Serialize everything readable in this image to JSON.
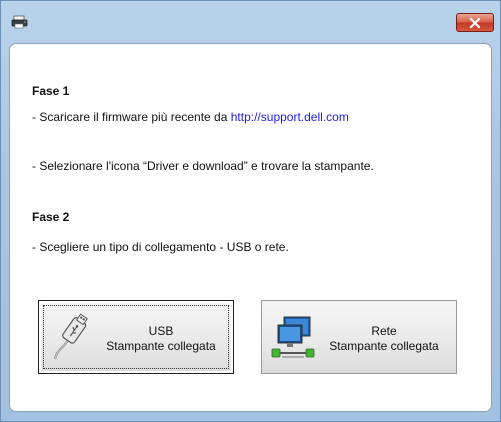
{
  "window": {
    "close_tooltip_icon": "close-icon",
    "app_icon": "printer-icon"
  },
  "step1": {
    "heading": "Fase 1",
    "line1_prefix": "- Scaricare il firmware più recente da ",
    "line1_link": "http://support.dell.com",
    "line2": "- Selezionare l'icona “Driver e download” e trovare la stampante."
  },
  "step2": {
    "heading": "Fase 2",
    "line1": "- Scegliere un tipo di collegamento - USB o rete."
  },
  "buttons": {
    "usb": {
      "title": "USB",
      "subtitle": "Stampante collegata",
      "icon": "usb-cable-icon"
    },
    "network": {
      "title": "Rete",
      "subtitle": "Stampante collegata",
      "icon": "network-icon"
    }
  },
  "colors": {
    "link": "#2020d8",
    "close_button": "#c4382a",
    "frame": "#a9c6e3"
  }
}
